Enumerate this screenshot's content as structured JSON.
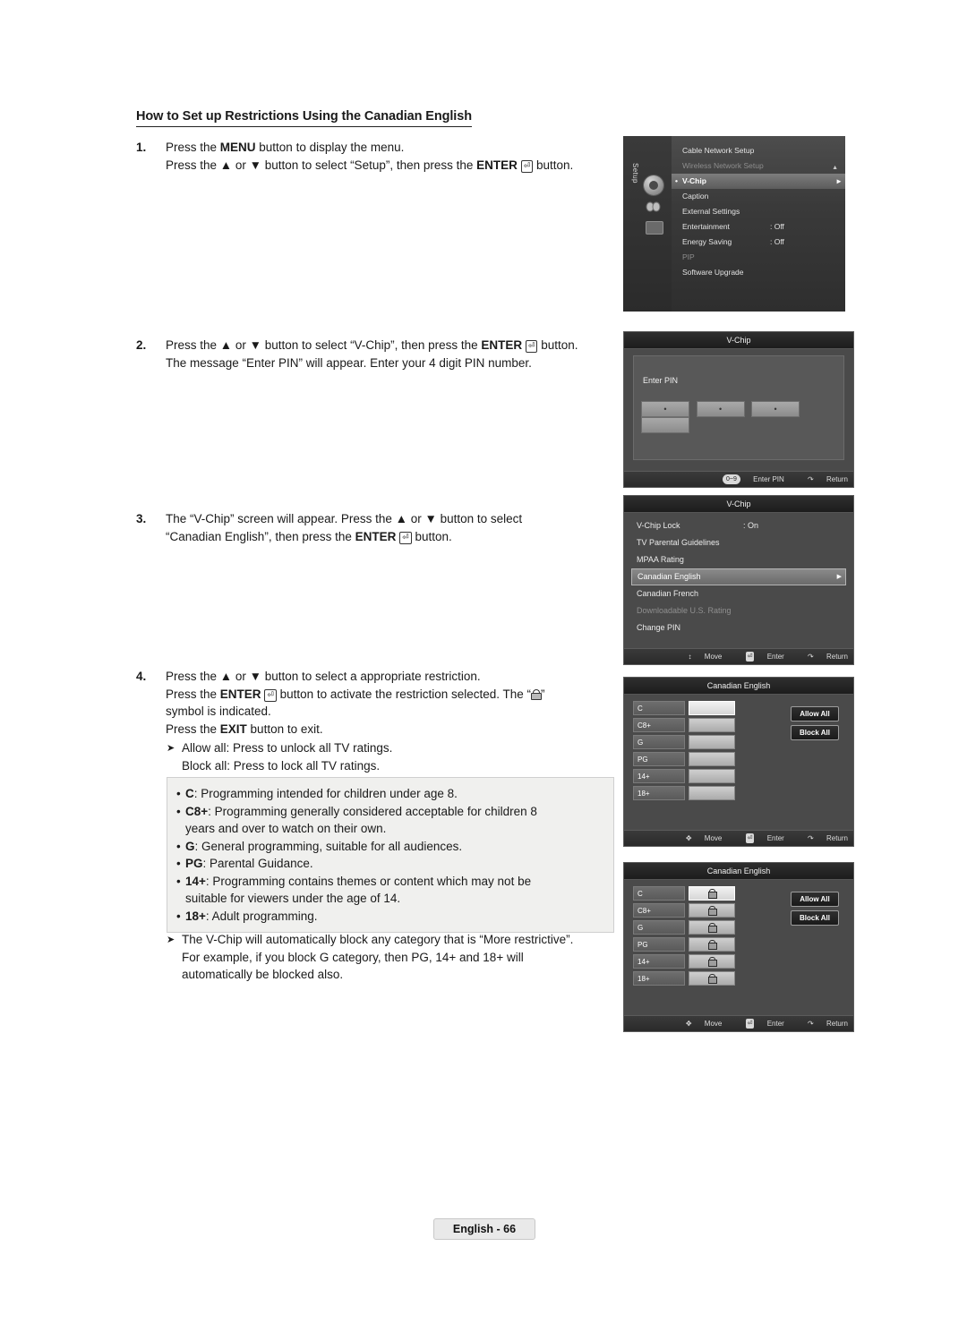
{
  "heading": "How to Set up Restrictions Using the Canadian English",
  "steps": [
    {
      "num": "1.",
      "lines": [
        "Press the MENU button to display the menu.",
        "Press the ▲ or ▼ button to select “Setup”, then press the ENTER ⏎ button."
      ]
    },
    {
      "num": "2.",
      "lines": [
        "Press the ▲ or ▼ button to select “V-Chip”, then press the ENTER ⏎ button.",
        "The message “Enter PIN” will appear. Enter your 4 digit PIN number."
      ]
    },
    {
      "num": "3.",
      "lines": [
        "The “V-Chip” screen will appear. Press the ▲ or ▼ button to select",
        "“Canadian English”, then press the ENTER ⏎ button."
      ]
    },
    {
      "num": "4.",
      "lines": [
        "Press the ▲ or ▼ button to select a appropriate restriction.",
        "Press the ENTER ⏎ button to activate the restriction selected. The “ ”",
        "symbol is indicated.",
        "Press the EXIT button to exit."
      ]
    }
  ],
  "allow_block": [
    "Allow all: Press to unlock all TV ratings.",
    "Block all: Press to lock all TV ratings."
  ],
  "rating_descriptions": [
    "C: Programming intended for children under age 8.",
    "C8+: Programming generally considered acceptable for children 8 years and over to watch on their own.",
    "G: General programming, suitable for all audiences.",
    "PG: Parental Guidance.",
    "14+: Programming contains themes or content which may not be suitable for viewers under the age of 14.",
    "18+: Adult programming."
  ],
  "footnote": [
    "The V-Chip will automatically block any category that is “More restrictive”.",
    "For example, if you block G category, then PG, 14+ and 18+ will",
    "automatically be blocked also."
  ],
  "page_footer": "English - 66",
  "screens": {
    "setup_menu": {
      "tab_label": "Setup",
      "items": [
        {
          "label": "Cable Network Setup",
          "value": "",
          "state": "normal"
        },
        {
          "label": "Wireless Network Setup",
          "value": "",
          "state": "dim"
        },
        {
          "label": "V-Chip",
          "value": "",
          "state": "selected"
        },
        {
          "label": "Caption",
          "value": "",
          "state": "normal"
        },
        {
          "label": "External Settings",
          "value": "",
          "state": "normal"
        },
        {
          "label": "Entertainment",
          "value": ": Off",
          "state": "normal"
        },
        {
          "label": "Energy Saving",
          "value": ": Off",
          "state": "normal"
        },
        {
          "label": "PIP",
          "value": "",
          "state": "dim"
        },
        {
          "label": "Software Upgrade",
          "value": "",
          "state": "normal"
        }
      ]
    },
    "enter_pin": {
      "title": "V-Chip",
      "label": "Enter PIN",
      "boxes": [
        "•",
        "•",
        "•",
        ""
      ],
      "footer": [
        {
          "key": "0~9",
          "text": "Enter PIN"
        },
        {
          "key": "↵",
          "text": "Return"
        }
      ]
    },
    "vchip": {
      "title": "V-Chip",
      "rows": [
        {
          "label": "V-Chip Lock",
          "value": ": On",
          "state": "normal"
        },
        {
          "label": "TV Parental Guidelines",
          "value": "",
          "state": "normal"
        },
        {
          "label": "MPAA Rating",
          "value": "",
          "state": "normal"
        },
        {
          "label": "Canadian English",
          "value": "",
          "state": "selected"
        },
        {
          "label": "Canadian French",
          "value": "",
          "state": "normal"
        },
        {
          "label": "Downloadable U.S. Rating",
          "value": "",
          "state": "dim"
        },
        {
          "label": "Change PIN",
          "value": "",
          "state": "normal"
        }
      ],
      "footer": [
        {
          "key": "↕",
          "text": "Move"
        },
        {
          "key": "⏎",
          "text": "Enter"
        },
        {
          "key": "↵",
          "text": "Return"
        }
      ]
    },
    "canadian_english_unlocked": {
      "title": "Canadian English",
      "rows": [
        {
          "label": "C",
          "locked": false,
          "highlight": true
        },
        {
          "label": "C8+",
          "locked": false,
          "highlight": false
        },
        {
          "label": "G",
          "locked": false,
          "highlight": false
        },
        {
          "label": "PG",
          "locked": false,
          "highlight": false
        },
        {
          "label": "14+",
          "locked": false,
          "highlight": false
        },
        {
          "label": "18+",
          "locked": false,
          "highlight": false
        }
      ],
      "allow_all": "Allow All",
      "block_all": "Block All",
      "footer": [
        {
          "key": "✥",
          "text": "Move"
        },
        {
          "key": "⏎",
          "text": "Enter"
        },
        {
          "key": "↵",
          "text": "Return"
        }
      ]
    },
    "canadian_english_locked": {
      "title": "Canadian English",
      "rows": [
        {
          "label": "C",
          "locked": true,
          "highlight": true
        },
        {
          "label": "C8+",
          "locked": true,
          "highlight": false
        },
        {
          "label": "G",
          "locked": true,
          "highlight": false
        },
        {
          "label": "PG",
          "locked": true,
          "highlight": false
        },
        {
          "label": "14+",
          "locked": true,
          "highlight": false
        },
        {
          "label": "18+",
          "locked": true,
          "highlight": false
        }
      ],
      "allow_all": "Allow All",
      "block_all": "Block All",
      "footer": [
        {
          "key": "✥",
          "text": "Move"
        },
        {
          "key": "⏎",
          "text": "Enter"
        },
        {
          "key": "↵",
          "text": "Return"
        }
      ]
    }
  }
}
